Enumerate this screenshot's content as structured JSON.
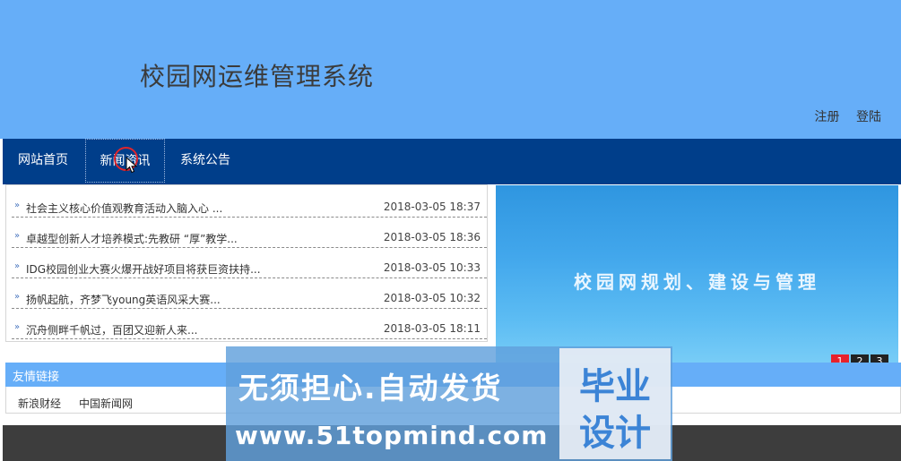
{
  "header": {
    "site_title": "校园网运维管理系统",
    "register": "注册",
    "login": "登陆"
  },
  "nav": {
    "items": [
      {
        "label": "网站首页"
      },
      {
        "label": "新闻资讯"
      },
      {
        "label": "系统公告"
      }
    ],
    "active": "新闻资讯"
  },
  "news": {
    "items": [
      {
        "title": "社会主义核心价值观教育活动入脑入心 ...",
        "date": "2018-03-05 18:37"
      },
      {
        "title": "卓越型创新人才培养模式:先教研 “厚”教学...",
        "date": "2018-03-05 18:36"
      },
      {
        "title": "IDG校园创业大赛火爆开战好项目将获巨资扶持...",
        "date": "2018-03-05 10:33"
      },
      {
        "title": "扬帆起航，齐梦飞young英语风采大赛...",
        "date": "2018-03-05 10:32"
      },
      {
        "title": "沉舟侧畔千帆过，百团又迎新人来...",
        "date": "2018-03-05 18:11"
      }
    ]
  },
  "banner": {
    "text": "校园网规划、建设与管理",
    "pages": [
      "1",
      "2",
      "3"
    ],
    "active_page": "1"
  },
  "links": {
    "title": "友情链接",
    "items": [
      {
        "label": "新浪财经"
      },
      {
        "label": "中国新闻网"
      }
    ]
  },
  "watermark": {
    "line1": "无须担心.自动发货",
    "line2": "www.51topmind.com",
    "badge1": "毕业",
    "badge2": "设计"
  },
  "colors": {
    "header_bg": "#66aef8",
    "nav_bg": "#003e8a",
    "active_page": "#e8212b",
    "footer_bg": "#3d3d3d"
  }
}
